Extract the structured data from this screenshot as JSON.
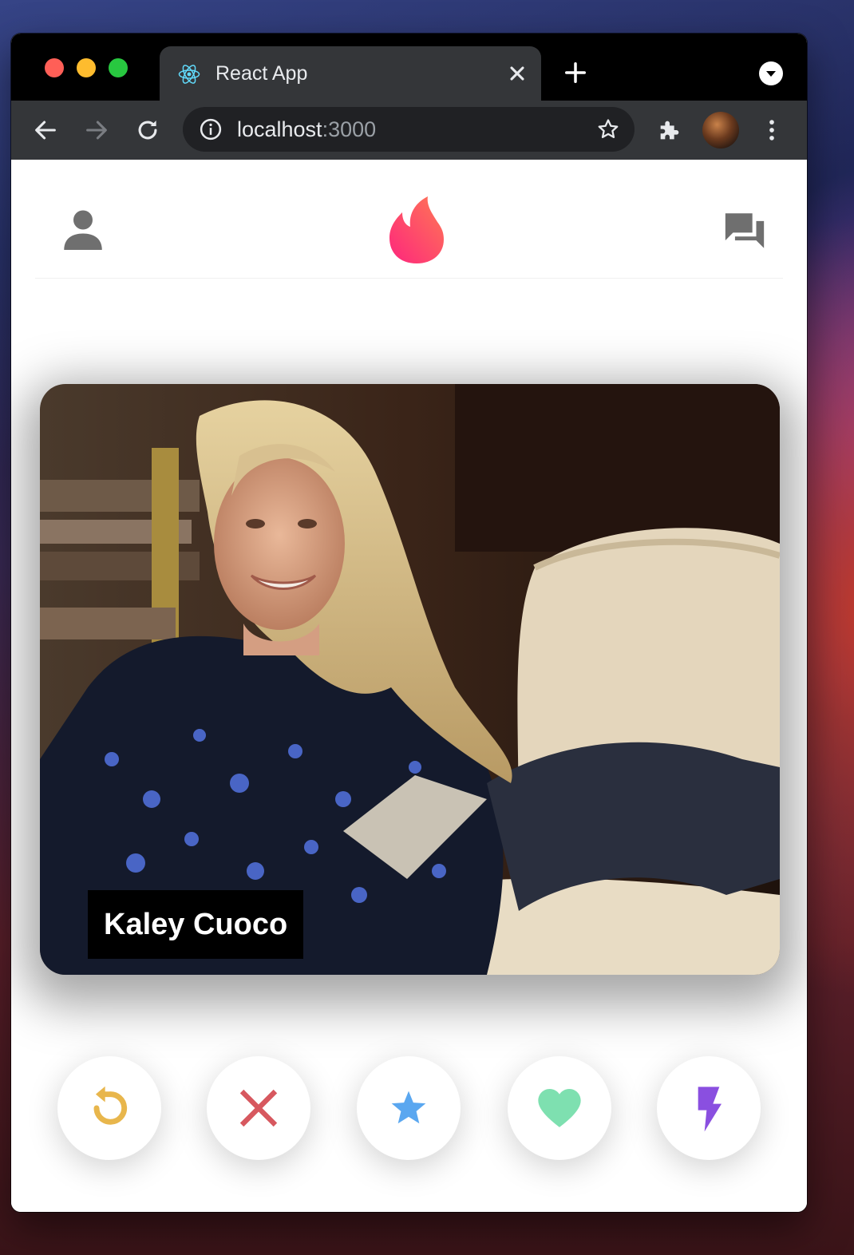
{
  "browser": {
    "tab_title": "React App",
    "url_host": "localhost",
    "url_port": ":3000",
    "icons": {
      "favicon": "react-icon",
      "tab_close": "close-icon",
      "new_tab": "plus-icon",
      "tab_search": "chevron-down-icon",
      "back": "arrow-left-icon",
      "forward": "arrow-right-icon",
      "reload": "reload-icon",
      "site_info": "info-icon",
      "bookmark": "star-outline-icon",
      "extensions": "puzzle-icon",
      "profile": "avatar",
      "menu": "kebab-menu-icon"
    }
  },
  "app": {
    "header": {
      "left_icon": "person-icon",
      "logo": "tinder-flame-logo",
      "right_icon": "forum-icon"
    },
    "card": {
      "name": "Kaley Cuoco"
    },
    "actions": [
      {
        "name": "replay-button",
        "icon": "replay-icon",
        "color": "#e8b64c"
      },
      {
        "name": "close-button",
        "icon": "close-icon",
        "color": "#d7585f"
      },
      {
        "name": "star-button",
        "icon": "star-icon",
        "color": "#5aa7f0"
      },
      {
        "name": "favorite-button",
        "icon": "heart-icon",
        "color": "#7ee0b0"
      },
      {
        "name": "flash-button",
        "icon": "flash-icon",
        "color": "#8a4fe0"
      }
    ]
  }
}
